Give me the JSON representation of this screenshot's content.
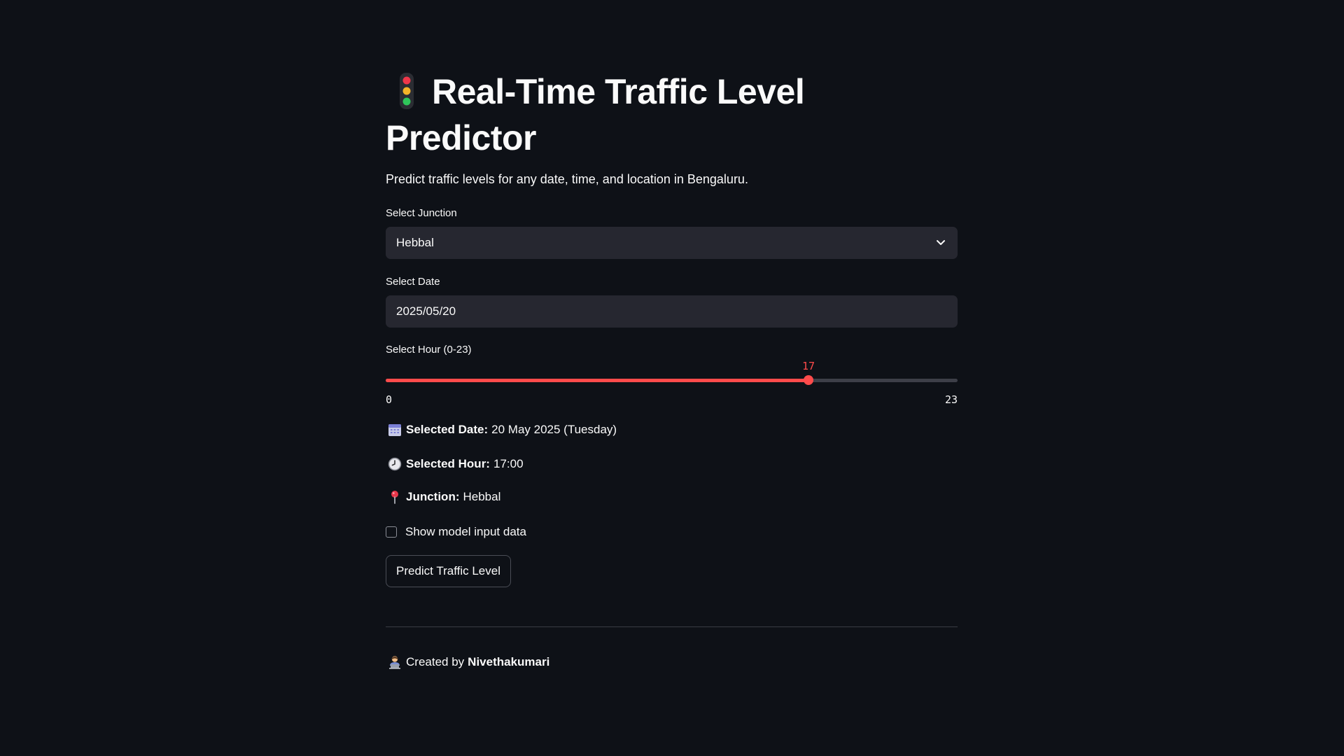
{
  "header": {
    "title": "Real-Time Traffic Level Predictor",
    "icon": "traffic-light-icon",
    "subtitle": "Predict traffic levels for any date, time, and location in Bengaluru."
  },
  "junction": {
    "label": "Select Junction",
    "value": "Hebbal"
  },
  "date": {
    "label": "Select Date",
    "value": "2025/05/20"
  },
  "hour": {
    "label": "Select Hour (0-23)",
    "value": "17",
    "min": "0",
    "max": "23",
    "fraction": 0.739
  },
  "summary": {
    "date_label": "Selected Date:",
    "date_value": "20 May 2025 (Tuesday)",
    "hour_label": "Selected Hour:",
    "hour_value": "17:00",
    "junction_label": "Junction:",
    "junction_value": "Hebbal"
  },
  "checkbox": {
    "label": "Show model input data",
    "checked": false
  },
  "button": {
    "label": "Predict Traffic Level"
  },
  "footer": {
    "prefix": "Created by",
    "author": "Nivethakumari"
  },
  "colors": {
    "background": "#0e1117",
    "accent": "#ff4b4b",
    "input_bg": "#262730"
  }
}
